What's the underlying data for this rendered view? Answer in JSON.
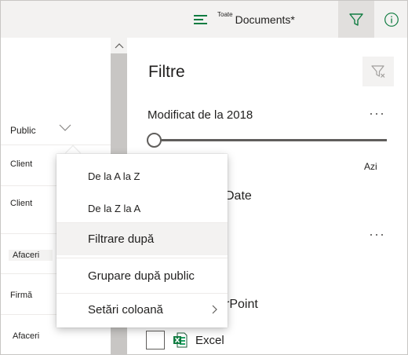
{
  "topbar": {
    "view_prefix": "Toate",
    "view_name": "Documents*",
    "filter_icon": "filter-icon",
    "info_icon": "info-icon"
  },
  "list": {
    "column_header": "Public",
    "rows": [
      "Client",
      "Client",
      "Afaceri",
      "Firmă",
      "Afaceri"
    ]
  },
  "filters_pane": {
    "title": "Filtre",
    "modified_label": "Modificat de la 2018",
    "more": "···",
    "slider_end": "Azi",
    "slider_value": 0,
    "partial_date_label": "Date",
    "partial_type_label": "rPoint",
    "excel_label": "Excel"
  },
  "menu": {
    "items": [
      "De la A la Z",
      "De la Z la A",
      "Filtrare după",
      "Grupare după public",
      "Setări coloană"
    ]
  },
  "colors": {
    "accent": "#107c41",
    "topbar_bg": "#f3f2f1",
    "selected_btn_bg": "#e1dfdd",
    "scrollbar": "#c8c6c4"
  }
}
